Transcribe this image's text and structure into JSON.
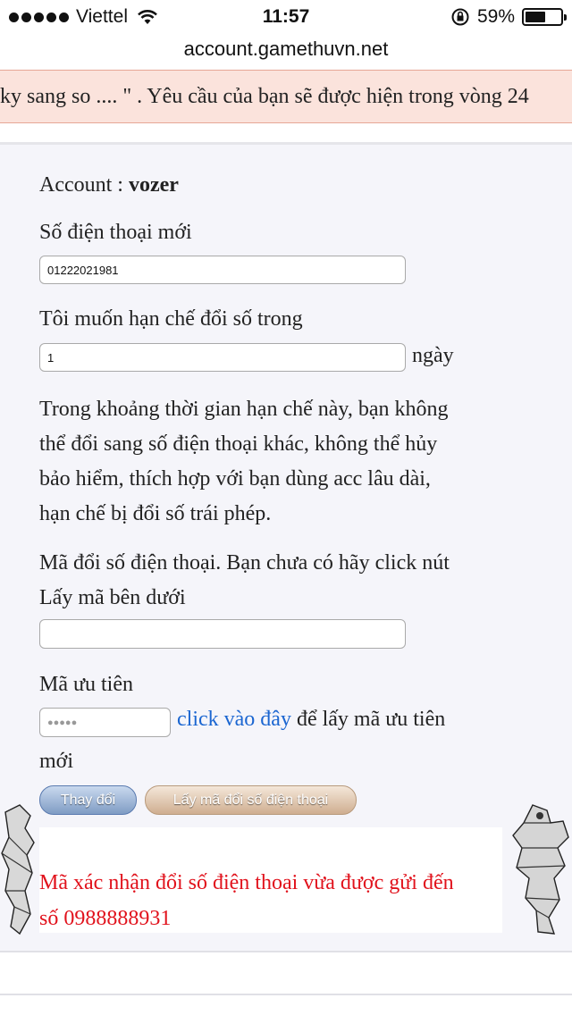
{
  "status_bar": {
    "carrier": "Viettel",
    "time": "11:57",
    "battery_percent": "59%",
    "battery_level": 0.59
  },
  "browser": {
    "url": "account.gamethuvn.net"
  },
  "notice": {
    "text": "ky sang so .... \" . Yêu cầu của bạn sẽ được hiện trong vòng 24"
  },
  "form": {
    "account_label": "Account : ",
    "account_name": "vozer",
    "new_phone_label": "Số điện thoại mới",
    "new_phone_value": "01222021981",
    "limit_label": "Tôi muốn hạn chế đổi số trong",
    "limit_value": "1",
    "limit_unit": "ngày",
    "description_lines": [
      "Trong khoảng thời gian hạn chế này, bạn không",
      "thể đổi sang số điện thoại khác, không thể hủy",
      "bảo hiểm, thích hợp với bạn dùng acc lâu dài,",
      "hạn chế bị đổi số trái phép."
    ],
    "code_label_lines": [
      "Mã đổi số điện thoại. Bạn chưa có hãy click nút",
      "Lấy mã bên dưới"
    ],
    "code_value": "",
    "priority_label": "Mã ưu tiên",
    "priority_value": "●●●●●",
    "priority_link": "click vào đây",
    "priority_hint_after": " để lấy mã ưu tiên",
    "priority_hint_line2": "mới",
    "change_button": "Thay đổi",
    "get_code_button": "Lấy mã đổi số điện thoại"
  },
  "result": {
    "line1": "Mã xác nhận đổi số điện thoại vừa được gửi đến",
    "line2": "số 0988888931"
  },
  "colors": {
    "panel_bg": "#f5f5fa",
    "notice_bg": "#fbe3dc",
    "link": "#1b66d1",
    "result_text": "#e1121c"
  }
}
